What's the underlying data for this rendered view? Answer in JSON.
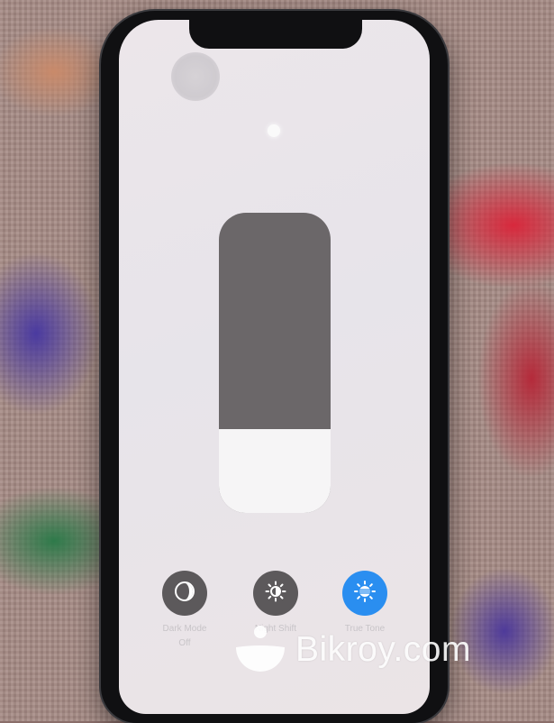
{
  "photo": {
    "watermark": "Bikroy.com"
  },
  "control_center": {
    "brightness": {
      "level_percent": 28
    },
    "buttons": [
      {
        "label": "Dark Mode",
        "state": "Off",
        "icon": "dark-mode-icon",
        "color": "#5c595b"
      },
      {
        "label": "Night Shift",
        "state": "",
        "icon": "night-shift-icon",
        "color": "#5c595b"
      },
      {
        "label": "True Tone",
        "state": "",
        "icon": "true-tone-icon",
        "color": "#2a8ef0"
      }
    ]
  }
}
